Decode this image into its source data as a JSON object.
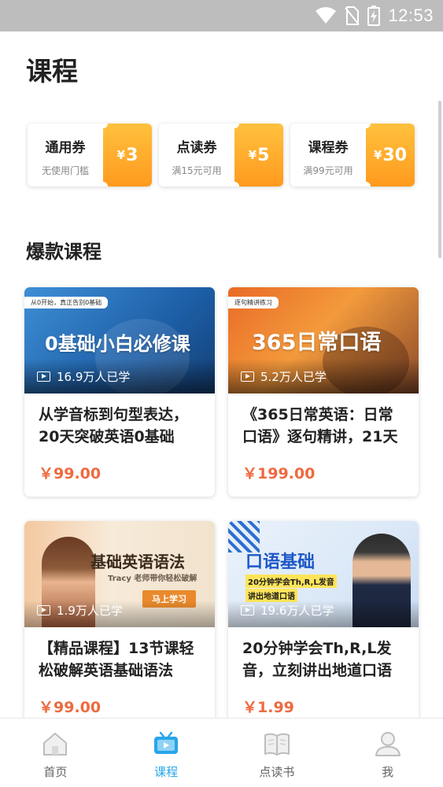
{
  "status_bar": {
    "time": "12:53"
  },
  "page": {
    "title": "课程"
  },
  "coupons": [
    {
      "name": "通用券",
      "condition": "无使用门槛",
      "currency": "¥",
      "value": "3"
    },
    {
      "name": "点读券",
      "condition": "满15元可用",
      "currency": "¥",
      "value": "5"
    },
    {
      "name": "课程券",
      "condition": "满99元可用",
      "currency": "¥",
      "value": "30"
    }
  ],
  "section": {
    "title": "爆款课程"
  },
  "courses": [
    {
      "thumb_tag": "从0开始，真正告别0基础",
      "thumb_heading": "0基础小白必修课",
      "learners": "16.9万人已学",
      "title": "从学音标到句型表达，20天突破英语0基础",
      "price": "￥99.00"
    },
    {
      "thumb_tag": "逐句精讲练习",
      "thumb_heading": "365日常口语",
      "learners": "5.2万人已学",
      "title": "《365日常英语：日常口语》逐句精讲，21天",
      "price": "￥199.00"
    },
    {
      "thumb_heading": "基础英语语法",
      "thumb_sub": "Tracy 老师带你轻松破解",
      "thumb_button": "马上学习",
      "learners": "1.9万人已学",
      "title": "【精品课程】13节课轻松破解英语基础语法",
      "price": "￥99.00"
    },
    {
      "thumb_heading": "口语基础",
      "thumb_sub": "20分钟学会Th,R,L发音",
      "thumb_sub2": "讲出地道口语",
      "learners": "19.6万人已学",
      "title": "20分钟学会Th,R,L发音，立刻讲出地道口语",
      "price": "￥1.99"
    }
  ],
  "tabbar": {
    "items": [
      {
        "label": "首页",
        "icon": "home-icon"
      },
      {
        "label": "课程",
        "icon": "tv-icon"
      },
      {
        "label": "点读书",
        "icon": "book-icon"
      },
      {
        "label": "我",
        "icon": "profile-icon"
      }
    ],
    "active": "课程"
  },
  "colors": {
    "accent": "#2aa5e8",
    "price": "#ee6a3f",
    "coupon_orange": "#ffa825"
  }
}
